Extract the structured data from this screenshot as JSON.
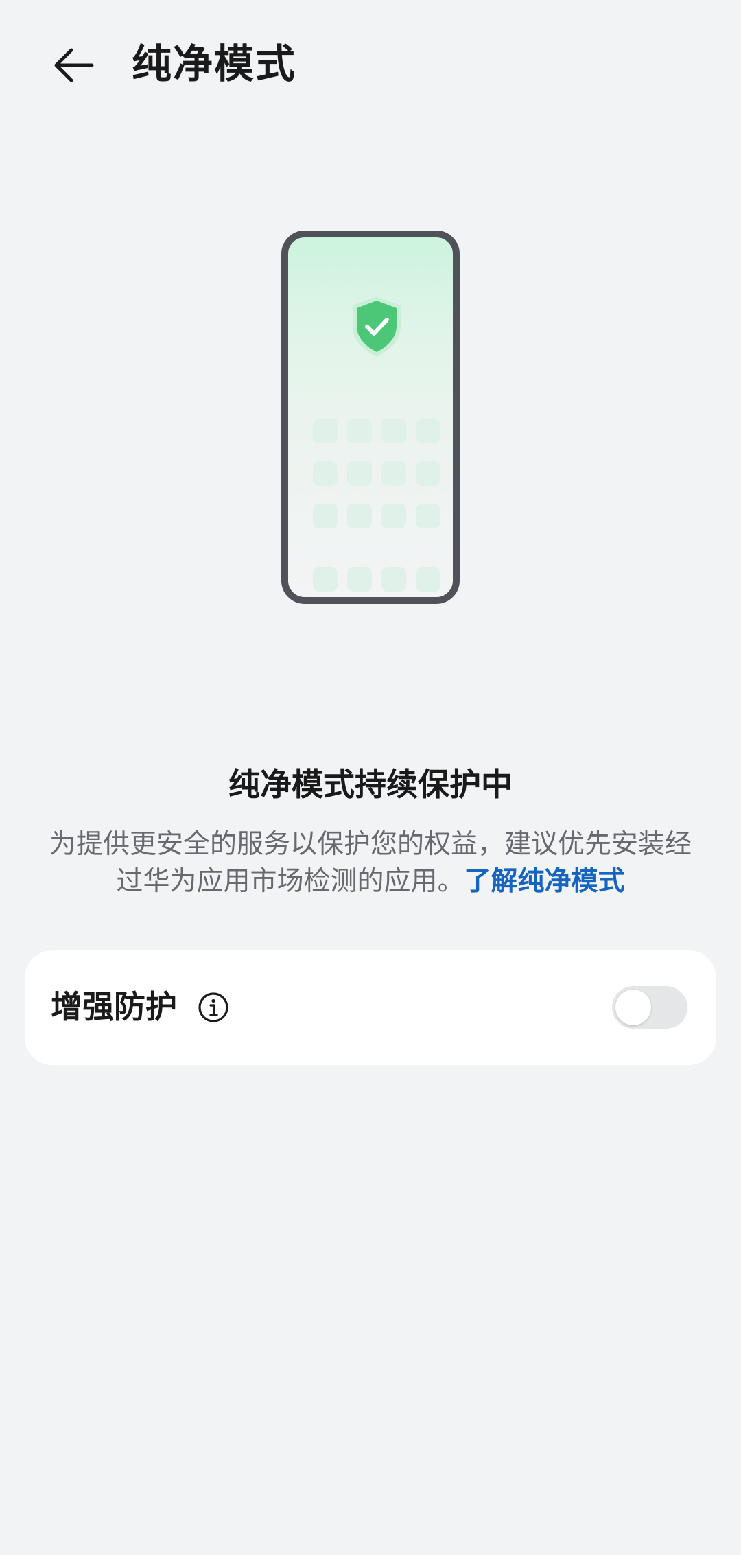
{
  "header": {
    "title": "纯净模式",
    "back_icon": "back-arrow-icon"
  },
  "illustration": {
    "icon": "shield-check-icon",
    "accent_color": "#4cc777"
  },
  "status": {
    "title": "纯净模式持续保护中",
    "description": "为提供更安全的服务以保护您的权益，建议优先安装经过华为应用市场检测的应用。",
    "link_label": "了解纯净模式",
    "link_color": "#1565c0"
  },
  "settings": {
    "enhanced_protection": {
      "label": "增强防护",
      "info_icon": "info-icon",
      "enabled": false
    }
  }
}
